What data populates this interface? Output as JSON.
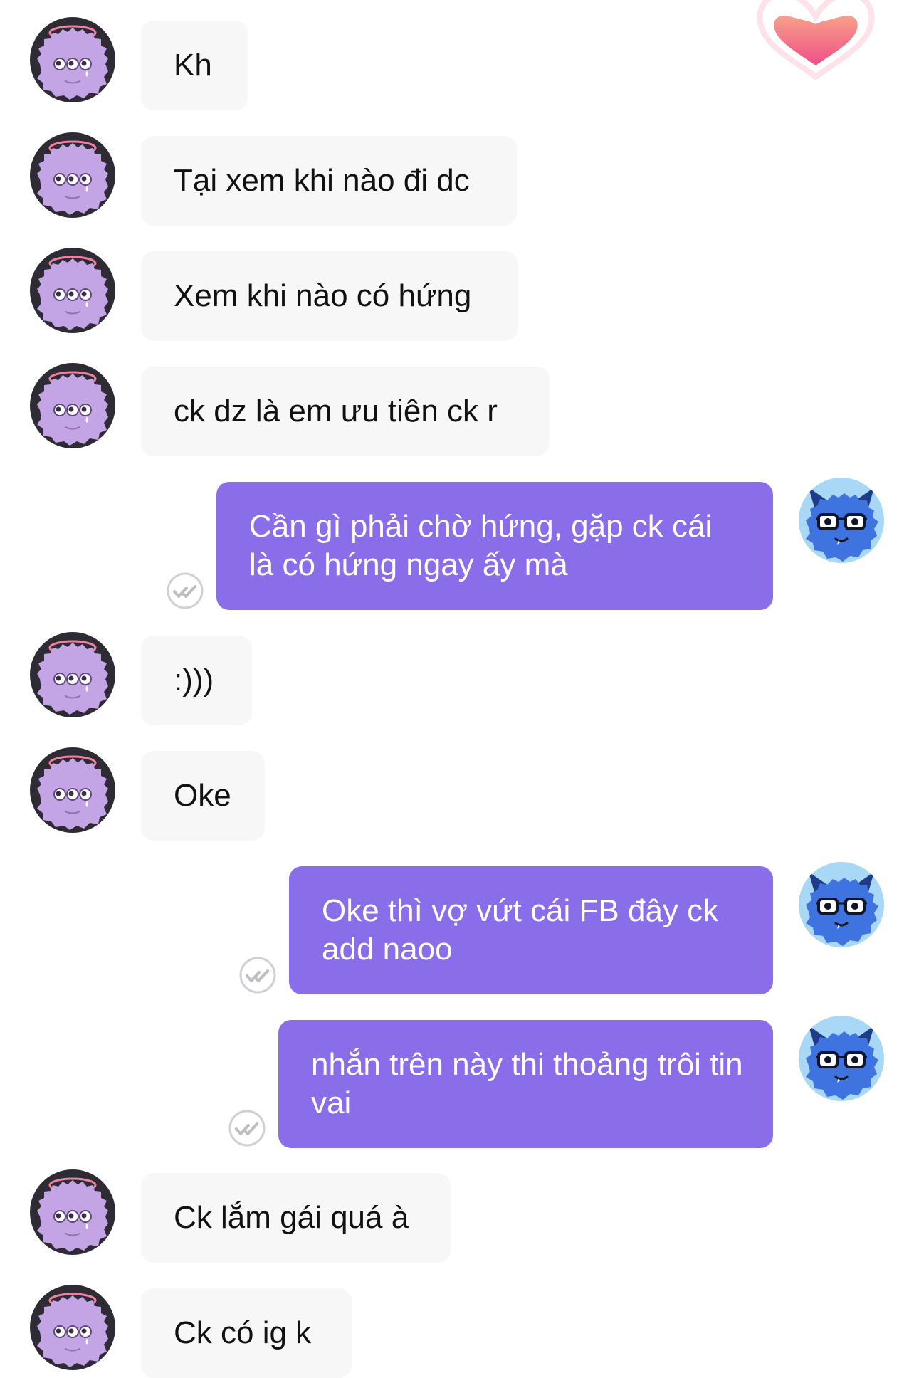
{
  "messages": [
    {
      "from": "them",
      "text": "Kh"
    },
    {
      "from": "them",
      "text": "Tại xem khi nào đi dc"
    },
    {
      "from": "them",
      "text": "Xem khi nào có hứng"
    },
    {
      "from": "them",
      "text": "ck dz là em ưu tiên ck r"
    },
    {
      "from": "me",
      "text": "Cần gì phải chờ hứng, gặp ck cái là có hứng ngay ấy mà"
    },
    {
      "from": "them",
      "text": ":)))"
    },
    {
      "from": "them",
      "text": "Oke"
    },
    {
      "from": "me",
      "text": "Oke thì vợ vứt cái FB đây ck add naoo"
    },
    {
      "from": "me",
      "text": "nhắn trên này thi thoảng trôi tin vai"
    },
    {
      "from": "them",
      "text": "Ck lắm gái quá à"
    },
    {
      "from": "them",
      "text": "Ck có ig k"
    }
  ],
  "icons": {
    "their_avatar": "purple-monster-avatar-icon",
    "my_avatar": "blue-monster-avatar-icon",
    "seen": "seen-checkmark-icon",
    "reaction": "heart-reaction-icon"
  },
  "colors": {
    "incoming_bubble": "#f7f7f8",
    "outgoing_bubble": "#8a6de9",
    "their_avatar_bg": "#2e2b35",
    "their_avatar_fur": "#c3a5e6",
    "my_avatar_bg": "#a8d8f5",
    "my_avatar_fur": "#3f74e0"
  }
}
